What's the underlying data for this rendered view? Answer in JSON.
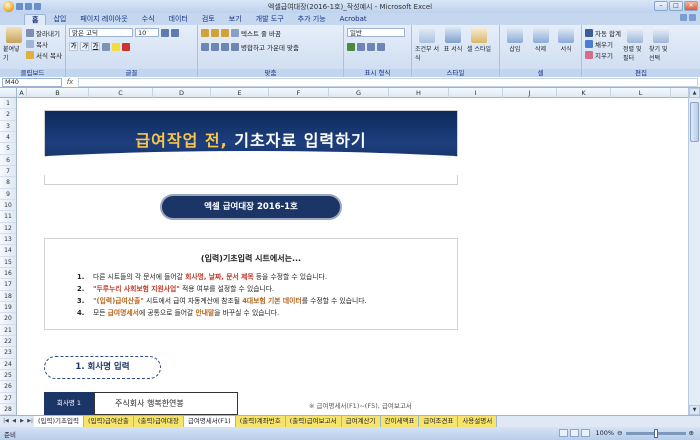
{
  "window": {
    "title": "엑셀급여대장(2016-1호)_작성예시 - Microsoft Excel",
    "buttons": [
      "–",
      "□",
      "✕"
    ]
  },
  "ribbon_tabs": [
    "홈",
    "삽입",
    "페이지 레이아웃",
    "수식",
    "데이터",
    "검토",
    "보기",
    "개발 도구",
    "추가 기능",
    "Acrobat"
  ],
  "ribbon": {
    "clipboard": {
      "paste": "붙여넣기",
      "cut": "잘라내기",
      "copy": "복사",
      "format_painter": "서식 복사",
      "label": "클립보드"
    },
    "font": {
      "name": "맑은 고딕",
      "size": "10",
      "bold": "가",
      "italic": "가",
      "underline": "가",
      "label": "글꼴"
    },
    "alignment": {
      "wrap": "텍스트 줄 바꿈",
      "merge": "병합하고 가운데 맞춤",
      "label": "맞춤"
    },
    "number": {
      "format": "일반",
      "label": "표시 형식"
    },
    "styles": {
      "conditional": "조건부 서식",
      "table": "표 서식",
      "cell": "셀 스타일",
      "label": "스타일"
    },
    "cells": {
      "insert": "삽입",
      "delete": "삭제",
      "format": "서식",
      "label": "셀"
    },
    "editing": {
      "autosum": "자동 합계",
      "fill": "채우기",
      "clear": "지우기",
      "sort": "정렬 및 필터",
      "find": "찾기 및 선택",
      "label": "편집"
    }
  },
  "formula_bar": {
    "name_box": "M40",
    "fx": "fx",
    "value": ""
  },
  "columns": [
    "A",
    "B",
    "C",
    "D",
    "E",
    "F",
    "G",
    "H",
    "I",
    "J",
    "K",
    "L"
  ],
  "rows": [
    "1",
    "2",
    "3",
    "4",
    "5",
    "6",
    "7",
    "8",
    "9",
    "10",
    "11",
    "12",
    "13",
    "14",
    "15",
    "16",
    "17",
    "18",
    "19",
    "20",
    "21",
    "22",
    "23",
    "24",
    "25",
    "26",
    "27",
    "28"
  ],
  "banner": {
    "title_yellow": "급여작업 전,",
    "title_white": " 기초자료 입력하기"
  },
  "pill": "엑셀 급여대장 2016-1호",
  "info": {
    "heading": "(입력)기초입력 시트에서는...",
    "items": [
      {
        "num": "1.",
        "pre": "다른 시트들의 각 문서에 들어갈 ",
        "hl": "회사명, 날짜, 문서 제목",
        "post": " 등을 수정할 수 있습니다.",
        "color": "red"
      },
      {
        "num": "2.",
        "pre": "",
        "hl": "\"두루누리 사회보험 지원사업\"",
        "post": " 적용 여부를 설정할 수 있습니다.",
        "color": "red"
      },
      {
        "num": "3.",
        "pre": "",
        "hl": "\"(입력)급여산출\"",
        "post": " 시트에서 급여 자동계산에 참조될 ",
        "hl2": "4대보험 기본 데이터",
        "post2": "를 수정할 수 있습니다.",
        "color": "brown"
      },
      {
        "num": "4.",
        "pre": "모든 ",
        "hl": "급여명세서",
        "post": "에 공통으로 들어갈 ",
        "hl2": "안내말",
        "post2": "을 바꾸실 수 있습니다.",
        "color": "brown"
      }
    ]
  },
  "section": "1. 회사명 입력",
  "company": {
    "label": "회사명 1",
    "value": "주식회사 행복한연봉",
    "note": "※ 급여명세서(F1)~(F5), 급여보고서"
  },
  "sheet_tabs": [
    {
      "label": "(입력)기초입력",
      "style": "w"
    },
    {
      "label": "(입력)급여산출",
      "style": "y"
    },
    {
      "label": "(출력)급여대장",
      "style": "y"
    },
    {
      "label": "급여명세서(F1)",
      "style": "w"
    },
    {
      "label": "(출력)계좌번호",
      "style": "y"
    },
    {
      "label": "(출력)급여보고서",
      "style": "y"
    },
    {
      "label": "급여계산기",
      "style": "y"
    },
    {
      "label": "간이세액표",
      "style": "y"
    },
    {
      "label": "급여조견표",
      "style": "y"
    },
    {
      "label": "사용설명서",
      "style": "y"
    }
  ],
  "status": {
    "ready": "준비",
    "zoom": "100%"
  }
}
